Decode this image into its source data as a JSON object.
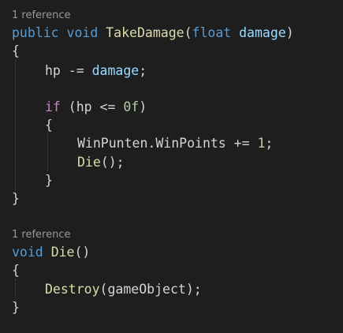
{
  "code_lens": [
    {
      "text": "1 reference"
    },
    {
      "text": "1 reference"
    }
  ],
  "tokens": {
    "public": "public",
    "void": "void",
    "TakeDamage": "TakeDamage",
    "open_paren": "(",
    "float": "float",
    "damage": "damage",
    "close_paren": ")",
    "brace_open": "{",
    "brace_close": "}",
    "hp": "hp",
    "minus_eq": " -= ",
    "semicolon": ";",
    "if": "if",
    "hp_paren": " (hp <= ",
    "zero": "0f",
    "close_paren_only": ")",
    "WinPunten": "WinPunten",
    "dot_WinPoints": ".WinPoints += ",
    "one": "1",
    "Die": "Die",
    "Die_call_suffix": "();",
    "Die_decl_suffix": "()",
    "Destroy": "Destroy",
    "Destroy_args": "(gameObject);"
  }
}
